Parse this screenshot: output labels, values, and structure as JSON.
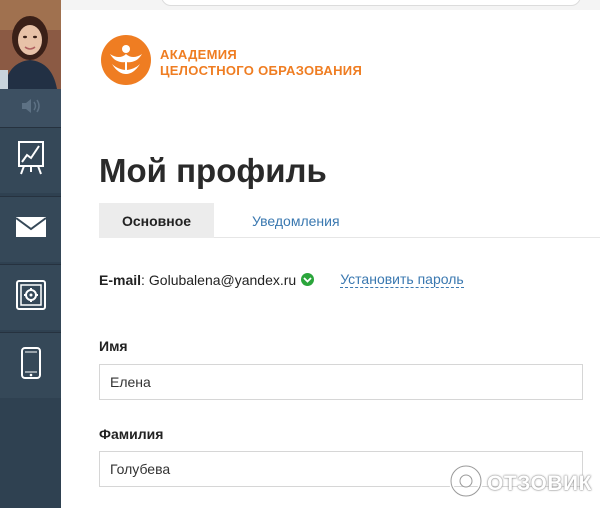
{
  "brand": {
    "name_line1": "Академия",
    "name_line2": "целостного образования",
    "color": "#ef7d22"
  },
  "sidebar": {
    "items": [
      {
        "icon": "sound-icon"
      },
      {
        "icon": "chart-icon"
      },
      {
        "icon": "mail-icon"
      },
      {
        "icon": "safe-icon"
      },
      {
        "icon": "phone-icon"
      }
    ]
  },
  "page": {
    "title": "Мой профиль"
  },
  "tabs": [
    {
      "label": "Основное",
      "active": true
    },
    {
      "label": "Уведомления",
      "active": false
    }
  ],
  "email": {
    "label": "E-mail",
    "separator": ":",
    "value": "Golubalena@yandex.ru",
    "verified": true,
    "set_password_link": "Установить пароль"
  },
  "form": {
    "first_name": {
      "label": "Имя",
      "value": "Елена"
    },
    "last_name": {
      "label": "Фамилия",
      "value": "Голубева"
    }
  },
  "watermark": {
    "text": "ОТЗОВИК"
  },
  "colors": {
    "sidebar": "#2f4151",
    "link": "#3a78b0",
    "verified": "#2aa53b"
  }
}
